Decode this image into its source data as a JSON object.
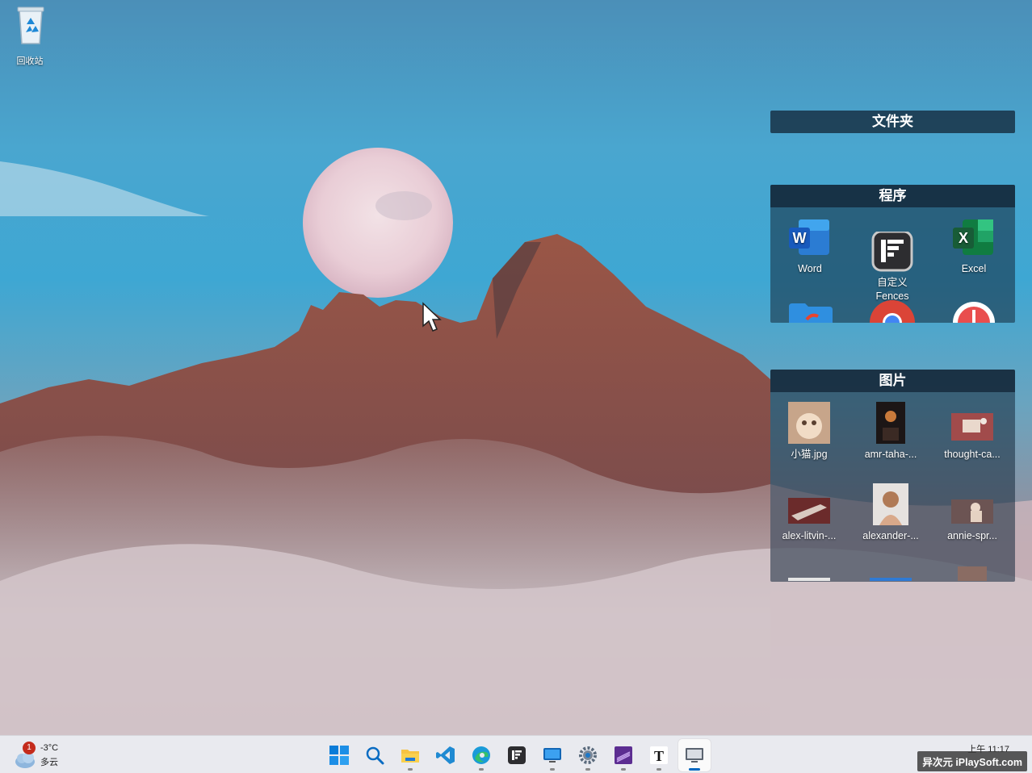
{
  "desktop": {
    "recycle_bin_label": "回收站"
  },
  "fences": {
    "folder": {
      "title": "文件夹"
    },
    "programs": {
      "title": "程序",
      "items": [
        {
          "label": "Word",
          "icon": "word-icon"
        },
        {
          "label": "自定义\nFences",
          "icon": "fences-icon"
        },
        {
          "label": "Excel",
          "icon": "excel-icon"
        },
        {
          "label": "",
          "icon": "folder-shortcut-icon"
        },
        {
          "label": "",
          "icon": "chrome-icon"
        },
        {
          "label": "",
          "icon": "music-icon"
        }
      ]
    },
    "pictures": {
      "title": "图片",
      "items": [
        {
          "label": "小猫.jpg"
        },
        {
          "label": "amr-taha-..."
        },
        {
          "label": "thought-ca..."
        },
        {
          "label": "alex-litvin-..."
        },
        {
          "label": "alexander-..."
        },
        {
          "label": "annie-spr..."
        }
      ]
    }
  },
  "taskbar": {
    "weather": {
      "temp": "-3°C",
      "condition": "多云",
      "badge": "1"
    },
    "apps": [
      "start-icon",
      "search-icon",
      "file-explorer-icon",
      "vscode-icon",
      "edge-icon",
      "fences-icon",
      "remote-desktop-icon",
      "settings-icon",
      "visual-studio-icon",
      "typora-icon",
      "display-switch-icon"
    ],
    "clock": "上午 11:17",
    "watermark": "异次元 iPlaySoft.com"
  },
  "colors": {
    "fence_bg": "#14283a",
    "taskbar_bg": "#e9eaef",
    "accent": "#0067c0"
  }
}
